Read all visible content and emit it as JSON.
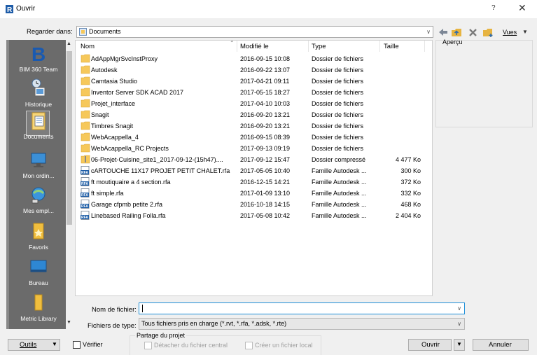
{
  "window": {
    "title": "Ouvrir",
    "help_label": "?",
    "close_label": "✕"
  },
  "lookin": {
    "label": "Regarder dans:",
    "value": "Documents"
  },
  "toolbar": {
    "views_label": "Vues"
  },
  "places": [
    {
      "label": "BIM 360 Team",
      "icon": "bim360-icon"
    },
    {
      "label": "Historique",
      "icon": "history-icon"
    },
    {
      "label": "Documents",
      "icon": "documents-icon",
      "selected": true
    },
    {
      "label": "Mon ordin...",
      "icon": "computer-icon"
    },
    {
      "label": "Mes empl...",
      "icon": "network-places-icon"
    },
    {
      "label": "Favoris",
      "icon": "favorites-icon"
    },
    {
      "label": "Bureau",
      "icon": "desktop-icon"
    },
    {
      "label": "Metric Library",
      "icon": "library-folder-icon"
    }
  ],
  "columns": {
    "name": "Nom",
    "modified": "Modifié le",
    "type": "Type",
    "size": "Taille"
  },
  "files": [
    {
      "name": "AdAppMgrSvcInstProxy",
      "modified": "2016-09-15 10:08",
      "type": "Dossier de fichiers",
      "size": "",
      "icon": "folder"
    },
    {
      "name": "Autodesk",
      "modified": "2016-09-22 13:07",
      "type": "Dossier de fichiers",
      "size": "",
      "icon": "folder"
    },
    {
      "name": "Camtasia Studio",
      "modified": "2017-04-21 09:11",
      "type": "Dossier de fichiers",
      "size": "",
      "icon": "folder"
    },
    {
      "name": "Inventor Server SDK ACAD 2017",
      "modified": "2017-05-15 18:27",
      "type": "Dossier de fichiers",
      "size": "",
      "icon": "folder"
    },
    {
      "name": "Projet_interface",
      "modified": "2017-04-10 10:03",
      "type": "Dossier de fichiers",
      "size": "",
      "icon": "folder"
    },
    {
      "name": "Snagit",
      "modified": "2016-09-20 13:21",
      "type": "Dossier de fichiers",
      "size": "",
      "icon": "folder"
    },
    {
      "name": "Timbres Snagit",
      "modified": "2016-09-20 13:21",
      "type": "Dossier de fichiers",
      "size": "",
      "icon": "folder"
    },
    {
      "name": "WebAcappella_4",
      "modified": "2016-09-15 08:39",
      "type": "Dossier de fichiers",
      "size": "",
      "icon": "folder"
    },
    {
      "name": "WebAcappella_RC Projects",
      "modified": "2017-09-13 09:19",
      "type": "Dossier de fichiers",
      "size": "",
      "icon": "folder"
    },
    {
      "name": "06-Projet-Cuisine_site1_2017-09-12-(15h47)....",
      "modified": "2017-09-12 15:47",
      "type": "Dossier compressé",
      "size": "4 477 Ko",
      "icon": "zip"
    },
    {
      "name": "cARTOUCHE 11X17 PROJET PETIT CHALET.rfa",
      "modified": "2017-05-05 10:40",
      "type": "Famille Autodesk ...",
      "size": "300 Ko",
      "icon": "rfa"
    },
    {
      "name": "ft moutiquaire a 4 section.rfa",
      "modified": "2016-12-15 14:21",
      "type": "Famille Autodesk ...",
      "size": "372 Ko",
      "icon": "rfa"
    },
    {
      "name": "ft simple.rfa",
      "modified": "2017-01-09 13:10",
      "type": "Famille Autodesk ...",
      "size": "332 Ko",
      "icon": "rfa"
    },
    {
      "name": "Garage cfpmb petite 2.rfa",
      "modified": "2016-10-18 14:15",
      "type": "Famille Autodesk ...",
      "size": "468 Ko",
      "icon": "rfa"
    },
    {
      "name": "Linebased Railing Folla.rfa",
      "modified": "2017-05-08 10:42",
      "type": "Famille Autodesk ...",
      "size": "2 404 Ko",
      "icon": "rfa"
    }
  ],
  "preview": {
    "label": "Aperçu"
  },
  "filename": {
    "label": "Nom de fichier:",
    "value": ""
  },
  "filetype": {
    "label": "Fichiers de type:",
    "value": "Tous fichiers pris en charge  (*.rvt, *.rfa, *.adsk, *.rte)"
  },
  "sharing": {
    "group_title": "Partage du projet",
    "detach_label": "Détacher du fichier central",
    "create_local_label": "Créer un fichier local"
  },
  "bottom": {
    "tools_label": "Outils",
    "verify_label": "Vérifier",
    "open_label": "Ouvrir",
    "cancel_label": "Annuler"
  },
  "colors": {
    "accent": "#1e8fd8",
    "folder": "#f6c85a",
    "places_bg": "#6b6b6b",
    "rfa": "#1f5fa8"
  }
}
